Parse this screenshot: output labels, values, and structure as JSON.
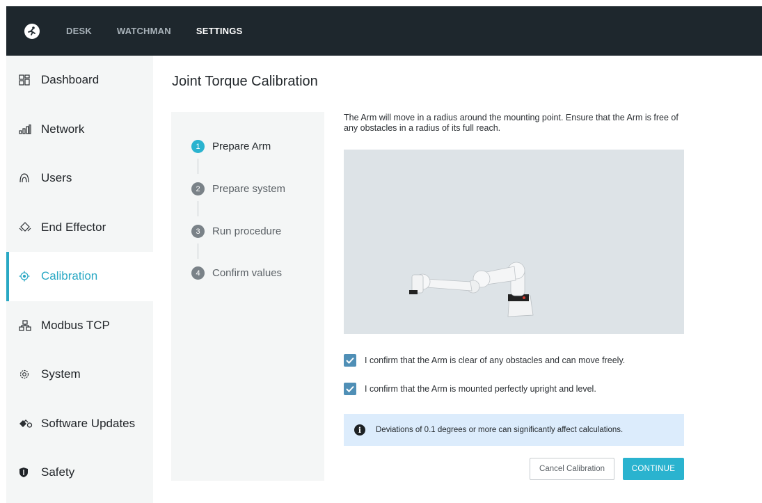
{
  "topbar": {
    "logo_icon": "franka-runner-logo",
    "nav": [
      "DESK",
      "WATCHMAN",
      "SETTINGS"
    ],
    "active_nav": "SETTINGS"
  },
  "sidebar": {
    "items": [
      {
        "label": "Dashboard",
        "icon": "dashboard-grid-icon"
      },
      {
        "label": "Network",
        "icon": "network-bars-icon"
      },
      {
        "label": "Users",
        "icon": "user-icon"
      },
      {
        "label": "End Effector",
        "icon": "gripper-icon"
      },
      {
        "label": "Calibration",
        "icon": "target-icon",
        "active": true
      },
      {
        "label": "Modbus TCP",
        "icon": "hierarchy-icon"
      },
      {
        "label": "System",
        "icon": "gear-icon"
      },
      {
        "label": "Software Updates",
        "icon": "update-icon"
      },
      {
        "label": "Safety",
        "icon": "shield-icon"
      }
    ],
    "accent_color": "#29a8c4"
  },
  "main": {
    "title": "Joint Torque Calibration",
    "steps": [
      {
        "num": "1",
        "label": "Prepare Arm",
        "active": true
      },
      {
        "num": "2",
        "label": "Prepare system"
      },
      {
        "num": "3",
        "label": "Run procedure"
      },
      {
        "num": "4",
        "label": "Confirm values"
      }
    ],
    "description": "The Arm will move in a radius around the mounting point. Ensure that the Arm is free of any obstacles in a radius of its full reach.",
    "confirmations": [
      {
        "label": "I confirm that the Arm is clear of any obstacles and can move freely.",
        "checked": true
      },
      {
        "label": "I confirm that the Arm is mounted perfectly upright and level.",
        "checked": true
      }
    ],
    "info": {
      "icon": "info-icon",
      "text": "Deviations of 0.1 degrees or more can significantly affect calculations."
    },
    "buttons": {
      "cancel": "Cancel Calibration",
      "continue": "CONTINUE"
    }
  }
}
